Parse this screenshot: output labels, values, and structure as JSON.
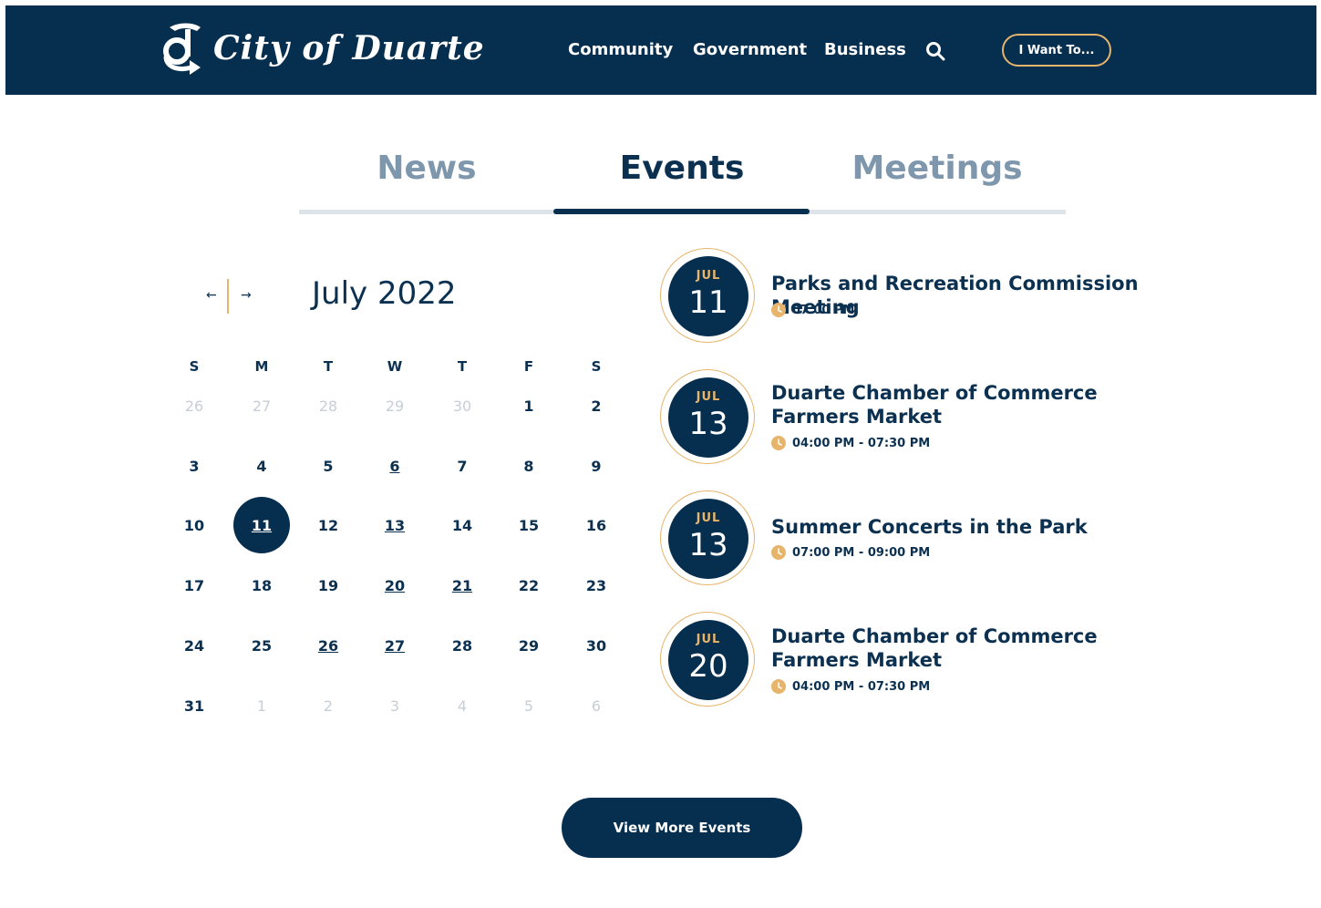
{
  "header": {
    "logo_text": "City of Duarte",
    "nav": [
      "Community",
      "Government",
      "Business"
    ],
    "cta_label": "I Want To..."
  },
  "tabs": {
    "items": [
      "News",
      "Events",
      "Meetings"
    ],
    "active": "Events"
  },
  "calendar": {
    "month_label": "July 2022",
    "prev_symbol": "←",
    "next_symbol": "→",
    "weekdays": [
      "S",
      "M",
      "T",
      "W",
      "T",
      "F",
      "S"
    ],
    "weeks": [
      [
        "26",
        "27",
        "28",
        "29",
        "30",
        "1",
        "2"
      ],
      [
        "3",
        "4",
        "5",
        "6",
        "7",
        "8",
        "9"
      ],
      [
        "10",
        "11",
        "12",
        "13",
        "14",
        "15",
        "16"
      ],
      [
        "17",
        "18",
        "19",
        "20",
        "21",
        "22",
        "23"
      ],
      [
        "24",
        "25",
        "26",
        "27",
        "28",
        "29",
        "30"
      ],
      [
        "31",
        "1",
        "2",
        "3",
        "4",
        "5",
        "6"
      ]
    ],
    "selected_day": "11",
    "days_with_events": [
      "6",
      "11",
      "13",
      "20",
      "21",
      "26",
      "27"
    ]
  },
  "events": [
    {
      "month": "JUL",
      "day": "11",
      "title": "Parks and Recreation Commission Meeting",
      "time": "07:00 PM"
    },
    {
      "month": "JUL",
      "day": "13",
      "title": "Duarte Chamber of Commerce Farmers Market",
      "time": "04:00 PM - 07:30 PM"
    },
    {
      "month": "JUL",
      "day": "13",
      "title": "Summer Concerts in the Park",
      "time": "07:00 PM - 09:00 PM"
    },
    {
      "month": "JUL",
      "day": "20",
      "title": "Duarte Chamber of Commerce Farmers Market",
      "time": "04:00 PM - 07:30 PM"
    }
  ],
  "footer_cta": {
    "label": "View More Events"
  },
  "colors": {
    "navy": "#062f4f",
    "gold": "#e7b46b",
    "muted_tab": "#7f97ac"
  },
  "icons": [
    "logo-mark-icon",
    "search-icon",
    "arrow-left-icon",
    "arrow-right-icon",
    "clock-icon"
  ]
}
